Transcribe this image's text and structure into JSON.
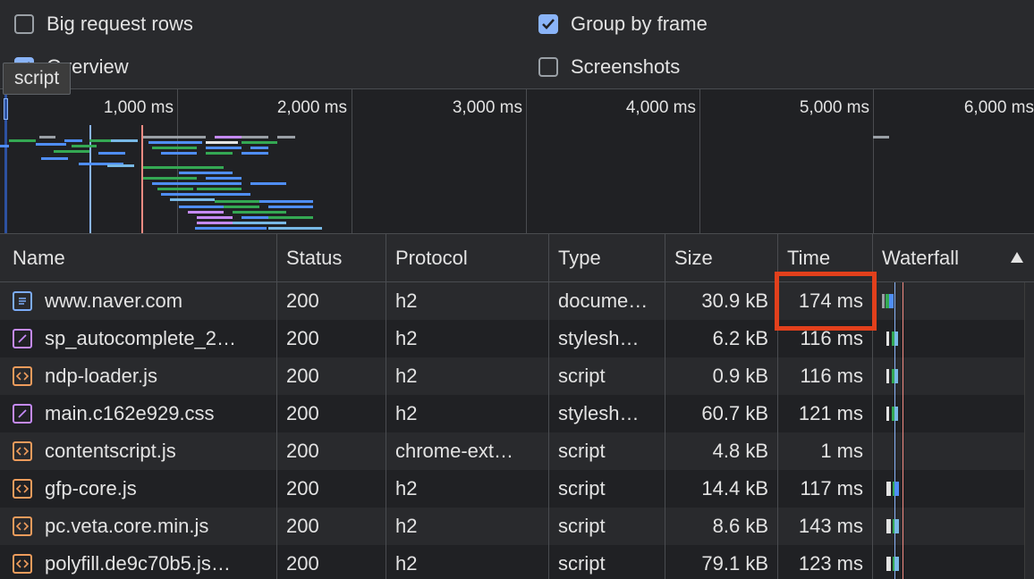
{
  "settings": {
    "big_request_rows": {
      "label": "Big request rows",
      "checked": false
    },
    "group_by_frame": {
      "label": "Group by frame",
      "checked": true
    },
    "overview": {
      "label": "Overview",
      "checked": true
    },
    "screenshots": {
      "label": "Screenshots",
      "checked": false
    }
  },
  "tooltip": "script",
  "overview": {
    "ticks": [
      "1,000 ms",
      "2,000 ms",
      "3,000 ms",
      "4,000 ms",
      "5,000 ms",
      "6,000 ms"
    ]
  },
  "table": {
    "columns": {
      "name": "Name",
      "status": "Status",
      "protocol": "Protocol",
      "type": "Type",
      "size": "Size",
      "time": "Time",
      "waterfall": "Waterfall"
    },
    "rows": [
      {
        "icon": "document-icon",
        "name": "www.naver.com",
        "status": "200",
        "protocol": "h2",
        "type": "docume…",
        "size": "30.9 kB",
        "time": "174 ms"
      },
      {
        "icon": "stylesheet-icon",
        "name": "sp_autocomplete_2…",
        "status": "200",
        "protocol": "h2",
        "type": "stylesh…",
        "size": "6.2 kB",
        "time": "116 ms"
      },
      {
        "icon": "script-icon",
        "name": "ndp-loader.js",
        "status": "200",
        "protocol": "h2",
        "type": "script",
        "size": "0.9 kB",
        "time": "116 ms"
      },
      {
        "icon": "stylesheet-icon",
        "name": "main.c162e929.css",
        "status": "200",
        "protocol": "h2",
        "type": "stylesh…",
        "size": "60.7 kB",
        "time": "121 ms"
      },
      {
        "icon": "script-icon",
        "name": "contentscript.js",
        "status": "200",
        "protocol": "chrome-ext…",
        "type": "script",
        "size": "4.8 kB",
        "time": "1 ms"
      },
      {
        "icon": "script-icon",
        "name": "gfp-core.js",
        "status": "200",
        "protocol": "h2",
        "type": "script",
        "size": "14.4 kB",
        "time": "117 ms"
      },
      {
        "icon": "script-icon",
        "name": "pc.veta.core.min.js",
        "status": "200",
        "protocol": "h2",
        "type": "script",
        "size": "8.6 kB",
        "time": "143 ms"
      },
      {
        "icon": "script-icon",
        "name": "polyfill.de9c70b5.js…",
        "status": "200",
        "protocol": "h2",
        "type": "script",
        "size": "79.1 kB",
        "time": "123 ms"
      }
    ]
  },
  "colors": {
    "accent": "#8ab4f8",
    "highlight": "#e2401c",
    "script_icon": "#ee9c5c",
    "stylesheet_icon": "#c58af9",
    "document_icon": "#7cacf8"
  }
}
